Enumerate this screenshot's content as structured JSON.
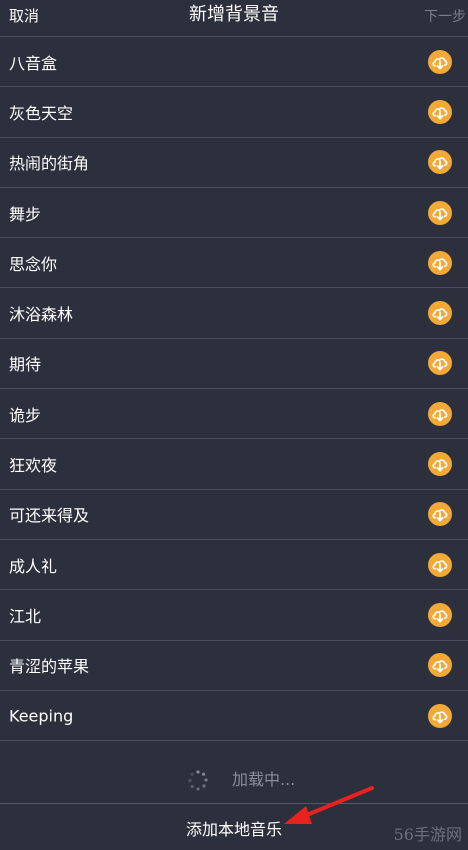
{
  "header": {
    "cancel_label": "取消",
    "title": "新增背景音",
    "next_label": "下一步"
  },
  "tracks": [
    {
      "name": "八音盒",
      "icon": "download-icon"
    },
    {
      "name": "灰色天空",
      "icon": "download-icon"
    },
    {
      "name": "热闹的街角",
      "icon": "download-icon"
    },
    {
      "name": "舞步",
      "icon": "download-icon"
    },
    {
      "name": "思念你",
      "icon": "download-icon"
    },
    {
      "name": "沐浴森林",
      "icon": "download-icon"
    },
    {
      "name": "期待",
      "icon": "download-icon"
    },
    {
      "name": "诡步",
      "icon": "download-icon"
    },
    {
      "name": "狂欢夜",
      "icon": "download-icon"
    },
    {
      "name": "可还来得及",
      "icon": "download-icon"
    },
    {
      "name": "成人礼",
      "icon": "download-icon"
    },
    {
      "name": "江北",
      "icon": "download-icon"
    },
    {
      "name": "青涩的苹果",
      "icon": "download-icon"
    },
    {
      "name": "Keeping",
      "icon": "download-icon"
    }
  ],
  "loading": {
    "text": "加载中..."
  },
  "footer": {
    "add_local_label": "添加本地音乐",
    "watermark": "56手游网"
  },
  "colors": {
    "background": "#2c2f3c",
    "divider": "#4a4e5c",
    "accent_orange": "#f2a938",
    "arrow_red": "#e8231f",
    "muted_text": "#7a7e8c"
  }
}
